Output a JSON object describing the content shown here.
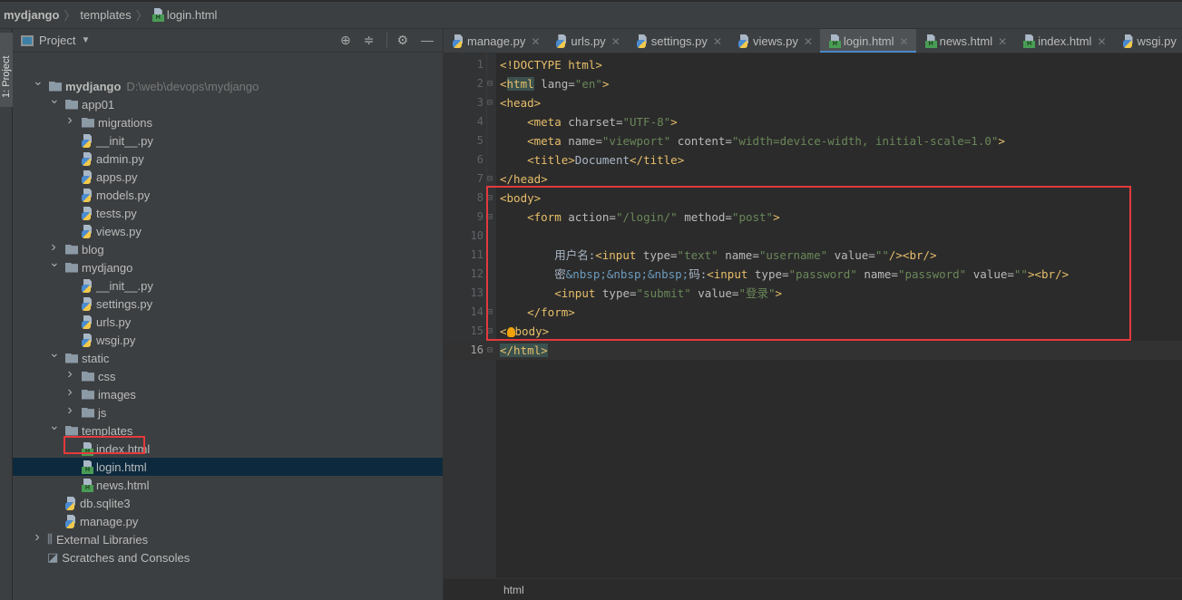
{
  "breadcrumb": [
    "mydjango",
    "templates",
    "login.html"
  ],
  "sidebar_strip": {
    "label": "1: Project"
  },
  "project_panel": {
    "title": "Project",
    "tools": [
      "crosshair-icon",
      "collapse-icon",
      "gear-icon",
      "minimize-icon"
    ],
    "tree": [
      {
        "label": "mydjango",
        "hint": "D:\\web\\devops\\mydjango",
        "level": 0,
        "type": "folder",
        "expanded": true,
        "bold": true
      },
      {
        "label": "app01",
        "level": 1,
        "type": "folder",
        "expanded": true
      },
      {
        "label": "migrations",
        "level": 2,
        "type": "folder",
        "expanded": false
      },
      {
        "label": "__init__.py",
        "level": 2,
        "type": "py"
      },
      {
        "label": "admin.py",
        "level": 2,
        "type": "py"
      },
      {
        "label": "apps.py",
        "level": 2,
        "type": "py"
      },
      {
        "label": "models.py",
        "level": 2,
        "type": "py"
      },
      {
        "label": "tests.py",
        "level": 2,
        "type": "py"
      },
      {
        "label": "views.py",
        "level": 2,
        "type": "py"
      },
      {
        "label": "blog",
        "level": 1,
        "type": "folder",
        "expanded": false
      },
      {
        "label": "mydjango",
        "level": 1,
        "type": "folder",
        "expanded": true
      },
      {
        "label": "__init__.py",
        "level": 2,
        "type": "py"
      },
      {
        "label": "settings.py",
        "level": 2,
        "type": "py"
      },
      {
        "label": "urls.py",
        "level": 2,
        "type": "py"
      },
      {
        "label": "wsgi.py",
        "level": 2,
        "type": "py"
      },
      {
        "label": "static",
        "level": 1,
        "type": "folder",
        "expanded": true
      },
      {
        "label": "css",
        "level": 2,
        "type": "folder",
        "expanded": false
      },
      {
        "label": "images",
        "level": 2,
        "type": "folder",
        "expanded": false
      },
      {
        "label": "js",
        "level": 2,
        "type": "folder",
        "expanded": false
      },
      {
        "label": "templates",
        "level": 1,
        "type": "folder",
        "expanded": true
      },
      {
        "label": "index.html",
        "level": 2,
        "type": "html"
      },
      {
        "label": "login.html",
        "level": 2,
        "type": "html",
        "selected": true
      },
      {
        "label": "news.html",
        "level": 2,
        "type": "html"
      },
      {
        "label": "db.sqlite3",
        "level": 1,
        "type": "db"
      },
      {
        "label": "manage.py",
        "level": 1,
        "type": "py"
      },
      {
        "label": "External Libraries",
        "level": 0,
        "type": "lib",
        "expanded": false
      },
      {
        "label": "Scratches and Consoles",
        "level": 0,
        "type": "scratch"
      }
    ]
  },
  "tabs": [
    {
      "label": "manage.py",
      "type": "py"
    },
    {
      "label": "urls.py",
      "type": "py"
    },
    {
      "label": "settings.py",
      "type": "py"
    },
    {
      "label": "views.py",
      "type": "py"
    },
    {
      "label": "login.html",
      "type": "html",
      "active": true
    },
    {
      "label": "news.html",
      "type": "html"
    },
    {
      "label": "index.html",
      "type": "html"
    },
    {
      "label": "wsgi.py",
      "type": "py"
    }
  ],
  "code": [
    [
      [
        "tag",
        "<!DOCTYPE html>"
      ]
    ],
    [
      [
        "tag",
        "<"
      ],
      [
        "tagh",
        "html"
      ],
      [
        "attr",
        " lang="
      ],
      [
        "str",
        "\"en\""
      ],
      [
        "tag",
        ">"
      ]
    ],
    [
      [
        "tag",
        "<head>"
      ]
    ],
    [
      [
        "txt",
        "    "
      ],
      [
        "tag",
        "<meta"
      ],
      [
        "attr",
        " charset="
      ],
      [
        "str",
        "\"UTF-8\""
      ],
      [
        "tag",
        ">"
      ]
    ],
    [
      [
        "txt",
        "    "
      ],
      [
        "tag",
        "<meta"
      ],
      [
        "attr",
        " name="
      ],
      [
        "str",
        "\"viewport\""
      ],
      [
        "attr",
        " content="
      ],
      [
        "str",
        "\"width=device-width, initial-scale=1.0\""
      ],
      [
        "tag",
        ">"
      ]
    ],
    [
      [
        "txt",
        "    "
      ],
      [
        "tag",
        "<title>"
      ],
      [
        "txt",
        "Document"
      ],
      [
        "tag",
        "</title>"
      ]
    ],
    [
      [
        "tag",
        "</head>"
      ]
    ],
    [
      [
        "tag",
        "<body>"
      ]
    ],
    [
      [
        "txt",
        "    "
      ],
      [
        "tag",
        "<form"
      ],
      [
        "attr",
        " action="
      ],
      [
        "str",
        "\"/login/\""
      ],
      [
        "attr",
        " method="
      ],
      [
        "str",
        "\"post\""
      ],
      [
        "tag",
        ">"
      ]
    ],
    [],
    [
      [
        "txt",
        "        用户名:"
      ],
      [
        "tag",
        "<input"
      ],
      [
        "attr",
        " type="
      ],
      [
        "str",
        "\"text\""
      ],
      [
        "attr",
        " name="
      ],
      [
        "str",
        "\"username\""
      ],
      [
        "attr",
        " value="
      ],
      [
        "str",
        "\"\""
      ],
      [
        "tag",
        "/><br/>"
      ]
    ],
    [
      [
        "txt",
        "        密"
      ],
      [
        "ent",
        "&nbsp;&nbsp;&nbsp;"
      ],
      [
        "txt",
        "码:"
      ],
      [
        "tag",
        "<input"
      ],
      [
        "attr",
        " type="
      ],
      [
        "str",
        "\"password\""
      ],
      [
        "attr",
        " name="
      ],
      [
        "str",
        "\"password\""
      ],
      [
        "attr",
        " value="
      ],
      [
        "str",
        "\"\""
      ],
      [
        "tag",
        "><br/>"
      ]
    ],
    [
      [
        "txt",
        "        "
      ],
      [
        "tag",
        "<input"
      ],
      [
        "attr",
        " type="
      ],
      [
        "str",
        "\"submit\""
      ],
      [
        "attr",
        " value="
      ],
      [
        "str",
        "\"登录\""
      ],
      [
        "tag",
        ">"
      ]
    ],
    [
      [
        "txt",
        "    "
      ],
      [
        "tag",
        "</form>"
      ]
    ],
    [
      [
        "tag",
        "<"
      ],
      [
        "bulb",
        ""
      ],
      [
        "tag",
        "body>"
      ]
    ],
    [
      [
        "tagh",
        "</html>"
      ]
    ]
  ],
  "current_line": 16,
  "status": {
    "breadcrumb": "html"
  },
  "colors": {
    "highlight_box": "#e5393c",
    "active_tab_underline": "#4a88c7",
    "tag": "#e8bf6a",
    "string": "#6a8759",
    "attribute": "#bababa",
    "entity": "#6d9cbe"
  }
}
